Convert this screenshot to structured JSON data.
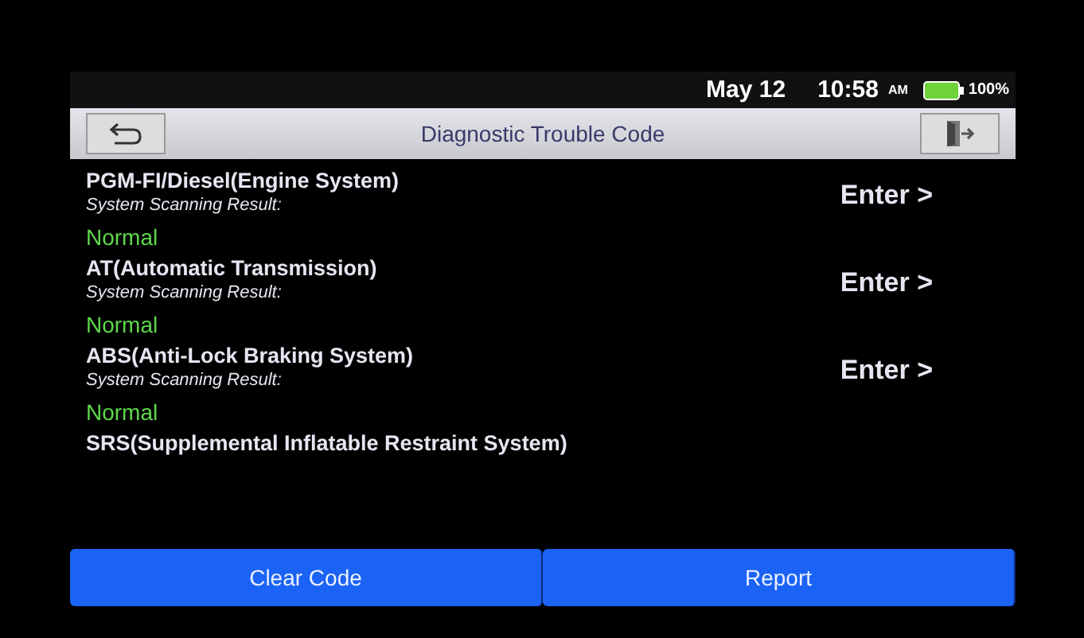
{
  "status_bar": {
    "date": "May 12",
    "time": "10:58",
    "ampm": "AM",
    "battery": "100%"
  },
  "header": {
    "title": "Diagnostic Trouble Code"
  },
  "systems": [
    {
      "name": "PGM-FI/Diesel(Engine System)",
      "subtitle": "System Scanning Result:",
      "result": "Normal",
      "action": "Enter >"
    },
    {
      "name": "AT(Automatic Transmission)",
      "subtitle": "System Scanning Result:",
      "result": "Normal",
      "action": "Enter >"
    },
    {
      "name": "ABS(Anti-Lock Braking System)",
      "subtitle": "System Scanning Result:",
      "result": "Normal",
      "action": "Enter >"
    },
    {
      "name": "SRS(Supplemental Inflatable Restraint System)"
    }
  ],
  "buttons": [
    "Clear Code",
    "Report"
  ]
}
